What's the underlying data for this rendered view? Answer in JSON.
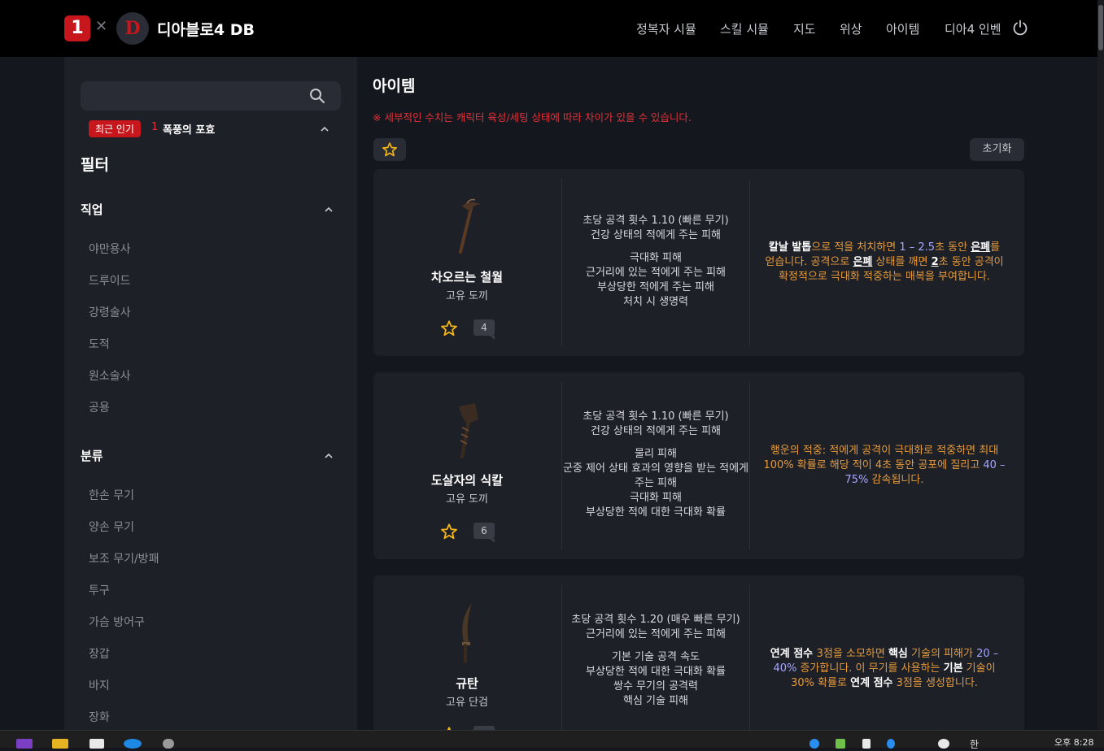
{
  "header": {
    "brand": "디아블로4 DB",
    "logo_left": "1",
    "logo_sep": "✕",
    "logo_right": "D",
    "nav": [
      "정복자 시뮬",
      "스킬 시뮬",
      "지도",
      "위상",
      "아이템",
      "디아4 인벤"
    ]
  },
  "sidebar": {
    "search_placeholder": "",
    "hot_badge": "최근 인기",
    "hot_rank": "1",
    "hot_item": "폭풍의 포효",
    "filter_title": "필터",
    "class_title": "직업",
    "classes": [
      "야만용사",
      "드루이드",
      "강령술사",
      "도적",
      "원소술사",
      "공용"
    ],
    "category_title": "분류",
    "categories": [
      "한손 무기",
      "양손 무기",
      "보조 무기/방패",
      "투구",
      "가슴 방어구",
      "장갑",
      "바지",
      "장화"
    ]
  },
  "main": {
    "title": "아이템",
    "notice": "※ 세부적인 수치는 캐릭터 육성/세팅 상태에 따라 차이가 있을 수 있습니다.",
    "reset_label": "초기화",
    "items": [
      {
        "name": "차오르는 철월",
        "type": "고유 도끼",
        "comments": "4",
        "stats_a": [
          "초당 공격 횟수 1.10 (빠른 무기)",
          "건강 상태의 적에게 주는 피해"
        ],
        "stats_b": [
          "극대화 피해",
          "근거리에 있는 적에게 주는 피해",
          "부상당한 적에게 주는 피해",
          "처치 시 생명력"
        ],
        "aspect": [
          {
            "t": "칼날 발톱",
            "k": "b"
          },
          {
            "t": "으로 적을 처치하면 ",
            "k": ""
          },
          {
            "t": "1 – 2.5",
            "k": "num"
          },
          {
            "t": "초 동안 ",
            "k": ""
          },
          {
            "t": "은폐",
            "k": "u"
          },
          {
            "t": "를 얻습니다. 공격으로 ",
            "k": ""
          },
          {
            "t": "은폐",
            "k": "u"
          },
          {
            "t": " 상태를 깨면 ",
            "k": ""
          },
          {
            "t": "2",
            "k": "u"
          },
          {
            "t": "초 동안 공격이 확정적으로 극대화 적중하는 매복을 부여합니다.",
            "k": ""
          }
        ]
      },
      {
        "name": "도살자의 식칼",
        "type": "고유 도끼",
        "comments": "6",
        "stats_a": [
          "초당 공격 횟수 1.10 (빠른 무기)",
          "건강 상태의 적에게 주는 피해"
        ],
        "stats_b": [
          "물리 피해",
          "군중 제어 상태 효과의 영향을 받는 적에게 주는 피해",
          "극대화 피해",
          "부상당한 적에 대한 극대화 확률"
        ],
        "aspect": [
          {
            "t": "행운의 적중:",
            "k": "o"
          },
          {
            "t": " 적에게 공격이 극대화로 적중하면 최대 ",
            "k": ""
          },
          {
            "t": "100%",
            "k": "o"
          },
          {
            "t": " 확률로 해당 적이 ",
            "k": ""
          },
          {
            "t": "4",
            "k": "o"
          },
          {
            "t": "초 동안 공포에 질리고 ",
            "k": ""
          },
          {
            "t": "40 – 75%",
            "k": "num"
          },
          {
            "t": " 감속됩니다.",
            "k": ""
          }
        ]
      },
      {
        "name": "규탄",
        "type": "고유 단검",
        "comments": "",
        "stats_a": [
          "초당 공격 횟수 1.20 (매우 빠른 무기)",
          "근거리에 있는 적에게 주는 피해"
        ],
        "stats_b": [
          "기본 기술 공격 속도",
          "부상당한 적에 대한 극대화 확률",
          "쌍수 무기의 공격력",
          "핵심 기술 피해"
        ],
        "aspect": [
          {
            "t": "연계 점수 ",
            "k": "b"
          },
          {
            "t": "3",
            "k": "o"
          },
          {
            "t": "점을 소모하면 ",
            "k": ""
          },
          {
            "t": "핵심",
            "k": "b"
          },
          {
            "t": " 기술의 피해가 ",
            "k": ""
          },
          {
            "t": "20 – 40%",
            "k": "num"
          },
          {
            "t": " 증가합니다. 이 무기를 사용하는 ",
            "k": ""
          },
          {
            "t": "기본",
            "k": "b"
          },
          {
            "t": " 기술이 ",
            "k": ""
          },
          {
            "t": "30%",
            "k": "o"
          },
          {
            "t": " 확률로 ",
            "k": ""
          },
          {
            "t": "연계 점수",
            "k": "b"
          },
          {
            "t": " ",
            "k": ""
          },
          {
            "t": "3",
            "k": "o"
          },
          {
            "t": "점을 생성합니다.",
            "k": ""
          }
        ]
      }
    ]
  },
  "taskbar": {
    "time": "오후 8:28",
    "ime": "한"
  },
  "colors": {
    "accent_red": "#c8161d",
    "aspect_orange": "#e59a3a",
    "value_purple": "#a7a6ff",
    "star_gold": "#f2b418"
  }
}
